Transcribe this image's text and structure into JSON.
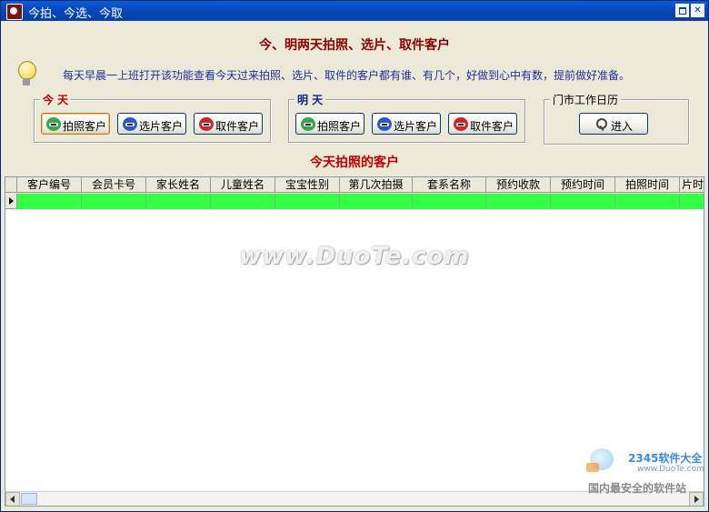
{
  "window": {
    "title": "今拍、今选、今取"
  },
  "main": {
    "heading": "今、明两天拍照、选片、取件客户",
    "tip": "每天早晨一上班打开该功能查看今天过来拍照、选片、取件的客户都有谁、有几个，好做到心中有数，提前做好准备。",
    "today": {
      "label": "今 天",
      "buttons": [
        "拍照客户",
        "选片客户",
        "取件客户"
      ]
    },
    "tomorrow": {
      "label": "明 天",
      "buttons": [
        "拍照客户",
        "选片客户",
        "取件客户"
      ]
    },
    "calendar": {
      "label": "门市工作日历",
      "enter": "进入"
    },
    "list_title": "今天拍照的客户"
  },
  "grid": {
    "columns": [
      "客户编号",
      "会员卡号",
      "家长姓名",
      "儿童姓名",
      "宝宝性别",
      "第几次拍摄",
      "套系名称",
      "预约收款",
      "预约时间",
      "拍照时间",
      "片时"
    ],
    "rows": [
      {
        "selected": true,
        "highlight": "#33ff44",
        "cells": [
          "",
          "",
          "",
          "",
          "",
          "",
          "",
          "",
          "",
          "",
          ""
        ]
      }
    ]
  },
  "watermark": {
    "text": "www.DuoTe.com"
  },
  "corner_logo": {
    "brand": "2345软件大全",
    "url": "www.DuoTe.com",
    "slogan": "国内最安全的软件站"
  },
  "colors": {
    "title_bar": "#0548c0",
    "heading": "#8b0000",
    "today_label": "#c00000",
    "tomorrow_label": "#0a2a8a",
    "tip_text": "#1f2f9f",
    "row_highlight": "#33ff44"
  },
  "icons": {
    "app": "app-icon",
    "tip": "lightbulb-icon",
    "photo": "green-face-icon",
    "select": "blue-face-icon",
    "pickup": "red-face-icon",
    "enter": "key-icon"
  }
}
